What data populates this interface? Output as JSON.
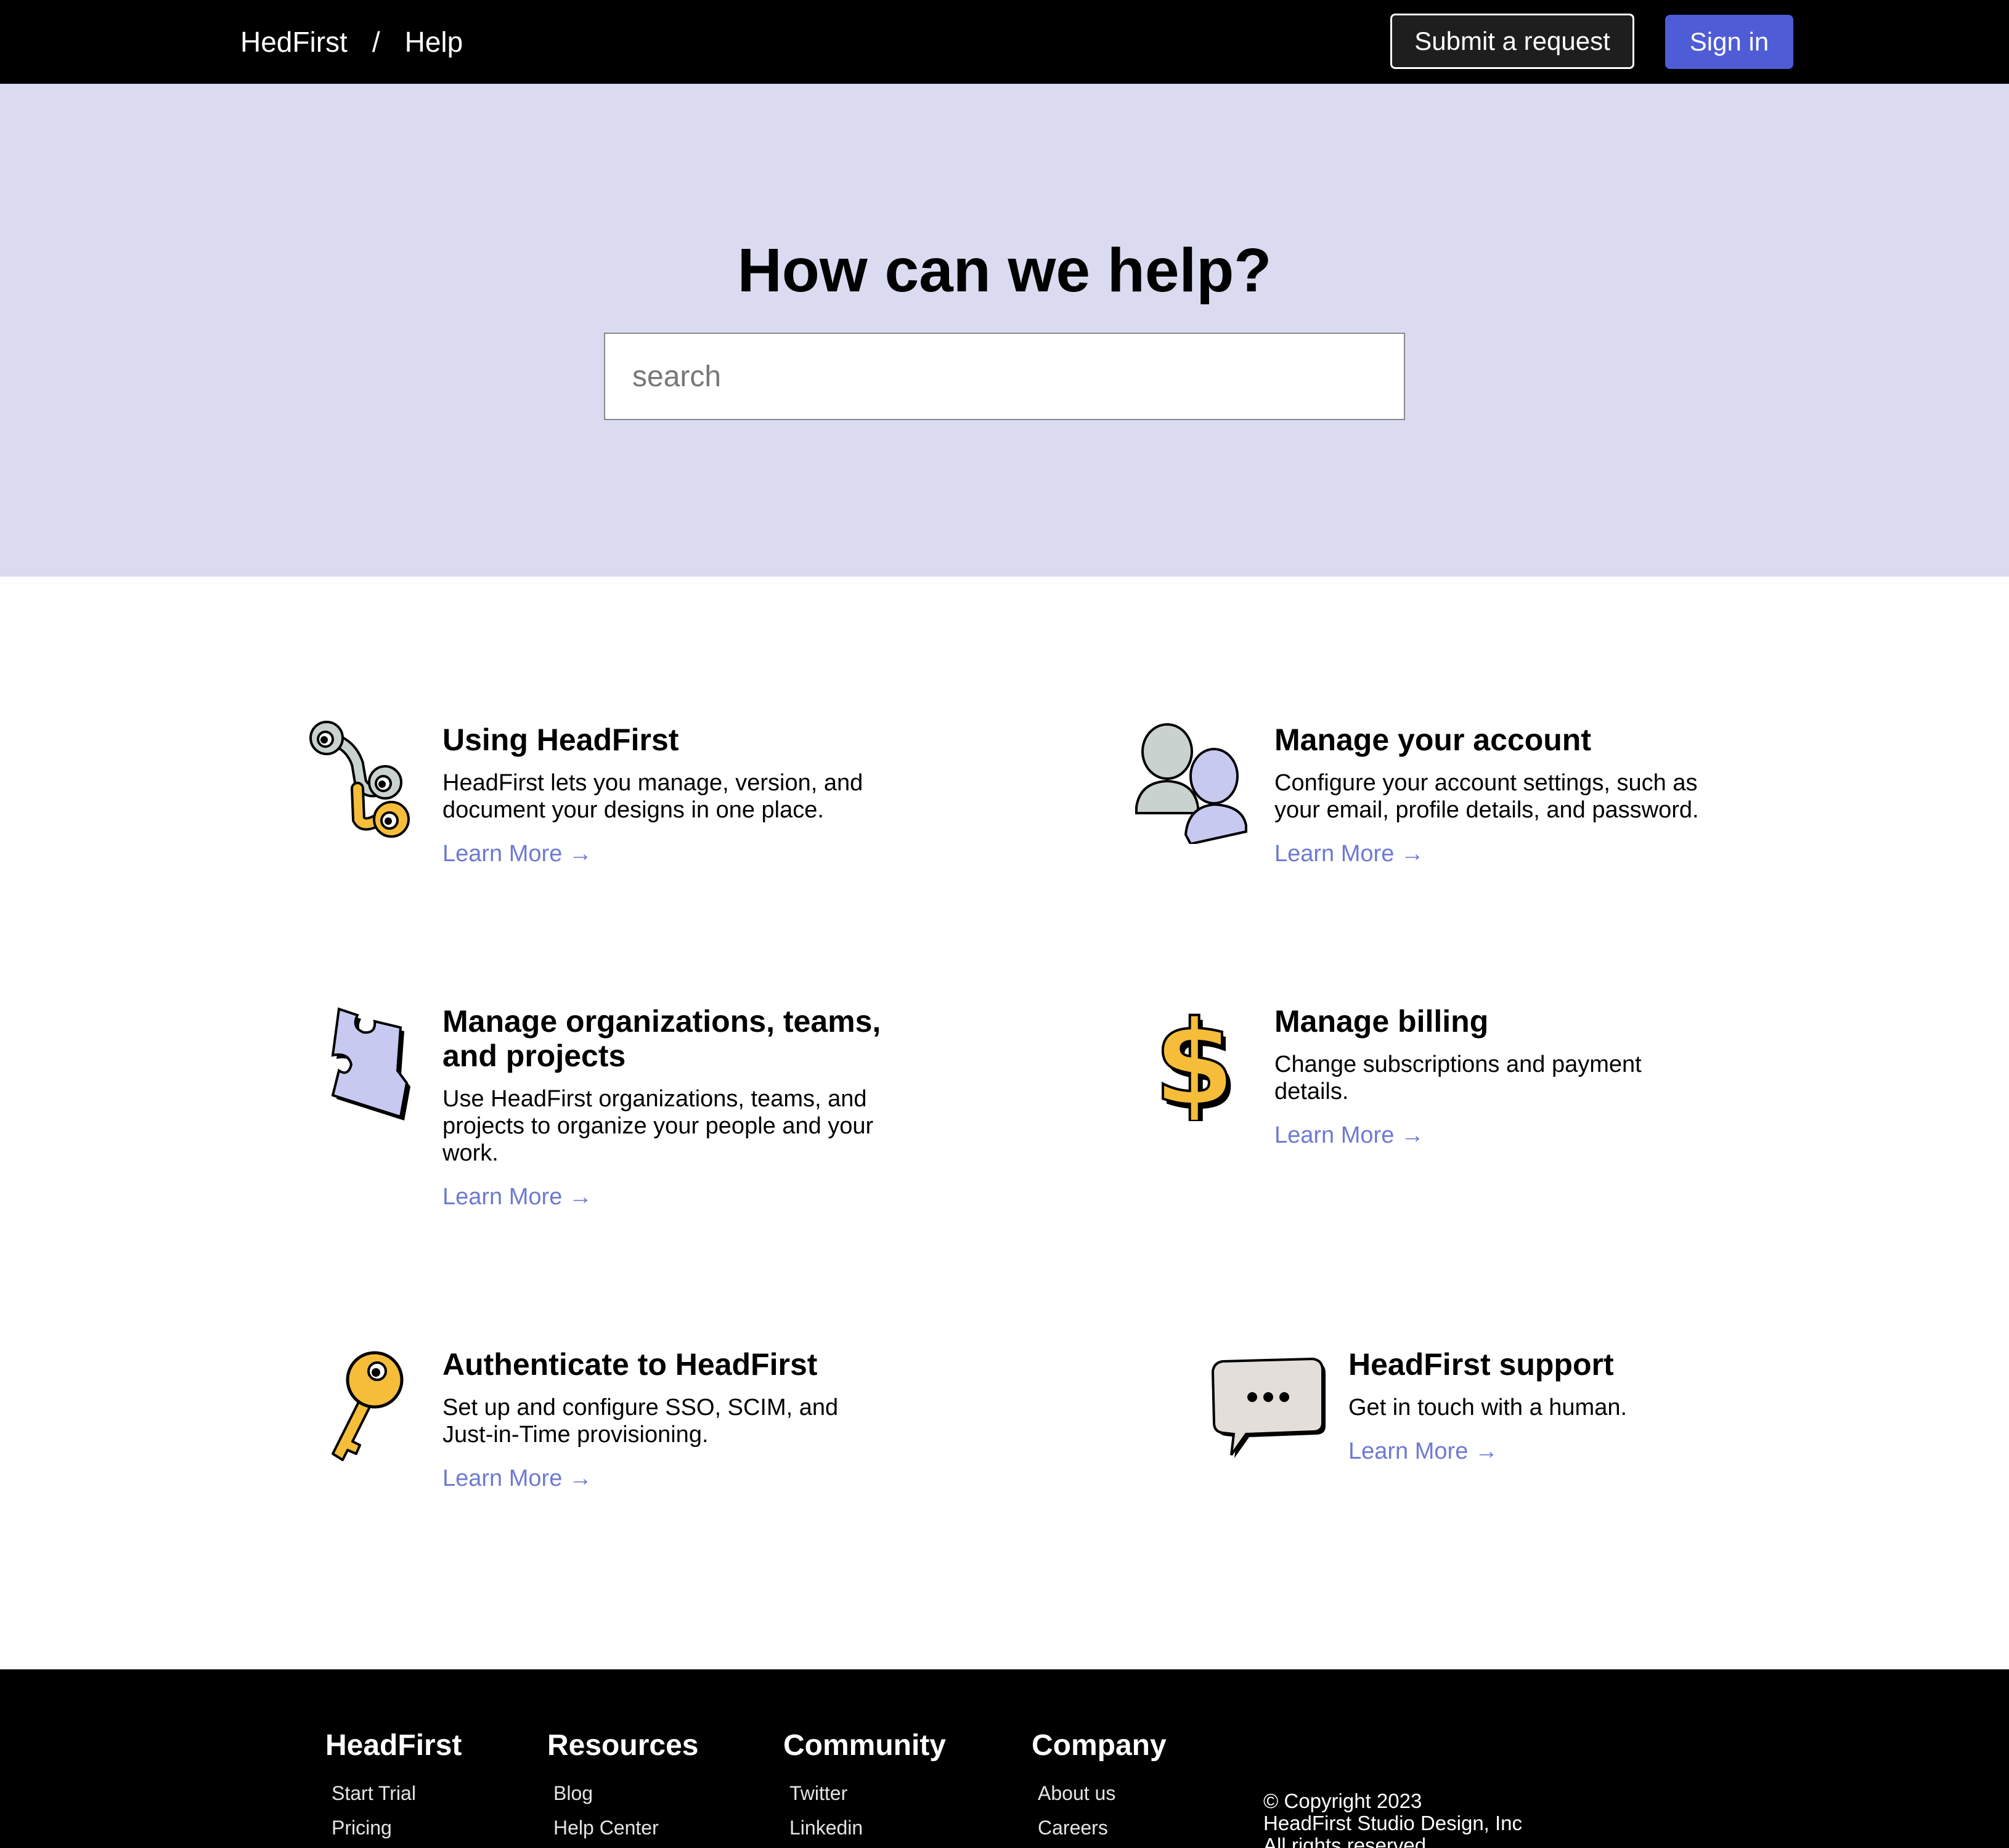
{
  "header": {
    "brand": "HedFirst",
    "separator": "/",
    "section": "Help",
    "submit_label": "Submit a request",
    "signin_label": "Sign in"
  },
  "hero": {
    "title": "How can we help?",
    "search_placeholder": "search"
  },
  "cards": [
    {
      "title": "Using HeadFirst",
      "desc": "HeadFirst lets you manage, version, and document your designs in one place.",
      "link": "Learn More →",
      "icon": "connector-icon"
    },
    {
      "title": "Manage your account",
      "desc": "Configure your account settings, such as your email, profile details, and password.",
      "link": "Learn More →",
      "icon": "users-icon"
    },
    {
      "title": "Manage organizations, teams, and projects",
      "desc": "Use HeadFirst organizations, teams, and projects to organize your people and your work.",
      "link": "Learn More →",
      "icon": "puzzle-icon"
    },
    {
      "title": "Manage billing",
      "desc": "Change subscriptions and payment details.",
      "link": "Learn More →",
      "icon": "dollar-icon"
    },
    {
      "title": "Authenticate to HeadFirst",
      "desc": "Set up and configure SSO, SCIM, and Just-in-Time provisioning.",
      "link": "Learn More →",
      "icon": "key-icon"
    },
    {
      "title": "HeadFirst support",
      "desc": "Get in touch with a human.",
      "link": "Learn More →",
      "icon": "chat-bubble-icon"
    }
  ],
  "footer": {
    "columns": [
      {
        "title": "HeadFirst",
        "links": [
          "Start Trial",
          "Pricing"
        ]
      },
      {
        "title": "Resources",
        "links": [
          "Blog",
          "Help Center"
        ]
      },
      {
        "title": "Community",
        "links": [
          "Twitter",
          "Linkedin"
        ]
      },
      {
        "title": "Company",
        "links": [
          "About us",
          "Careers"
        ]
      }
    ],
    "copyright": [
      "© Copyright 2023",
      "HeadFirst Studio Design, Inc",
      "All rights reserved"
    ]
  },
  "colors": {
    "hero_bg": "#dadbf0",
    "accent": "#4e5cd6",
    "link": "#6e7ad0",
    "icon_yellow": "#f5bd3a",
    "icon_lavender": "#c7c9f1",
    "icon_gray": "#c9d2cf"
  }
}
